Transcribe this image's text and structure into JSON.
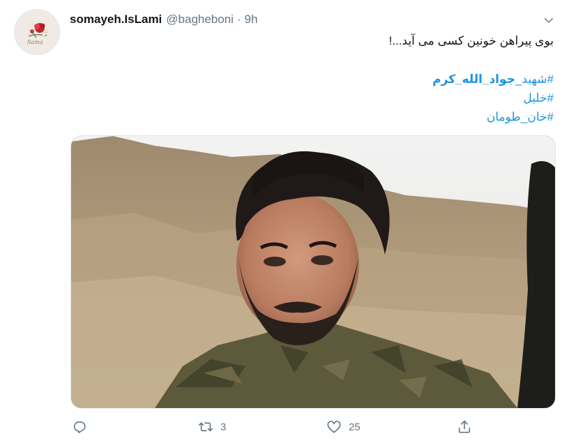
{
  "user": {
    "display_name": "somayeh.IsLami",
    "handle": "@bagheboni",
    "separator": "·",
    "time": "9h",
    "avatar_caption": "Sama"
  },
  "tweet": {
    "text": "بوی پیراهن خونین کسی می آید...!",
    "hashtags": [
      {
        "hash": "#",
        "prefix": "شهید_",
        "bold": "جواد_الله_کرم"
      },
      {
        "hash": "#",
        "prefix": "خلیل",
        "bold": ""
      },
      {
        "hash": "#",
        "prefix": "خان_طومان",
        "bold": ""
      }
    ]
  },
  "actions": {
    "reply_count": "",
    "retweet_count": "3",
    "like_count": "25"
  },
  "icons": {
    "menu": "chevron-down-icon",
    "reply": "reply-icon",
    "retweet": "retweet-icon",
    "like": "heart-icon",
    "share": "share-icon"
  },
  "colors": {
    "link": "#1b95e0",
    "muted": "#657786",
    "text": "#14171a"
  }
}
